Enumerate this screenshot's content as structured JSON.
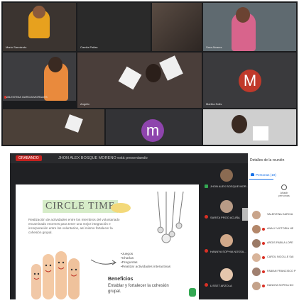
{
  "top_grid": {
    "tiles": [
      {
        "name": "Mario Sarmiento"
      },
      {
        "name": "Camila Pallas"
      },
      {
        "name": ""
      },
      {
        "name": "Sara Alvarez"
      },
      {
        "name": "VALENTINA GARCIA MORALES"
      },
      {
        "name": "Angelic"
      },
      {
        "name": "Martha Solis"
      },
      {
        "name": ""
      },
      {
        "name": ""
      },
      {
        "name": ""
      }
    ],
    "avatar_m_red": "M",
    "avatar_m_purple": "m"
  },
  "meet": {
    "rec_label": "GRABANDO",
    "presenter_text": "JHON ALEX BOSQUE MORENO está presentando",
    "slide": {
      "title": "CIRCLE TIME",
      "paragraph": "Realización de actividades entre los miembros del voluntariado encaminado enormes para tener una mejor integración e incorporación entre los voluntarios, así mismo fortalecer la cohesión grupal.",
      "bullets": [
        "•Juegos",
        "•Charlas",
        "•Preguntas",
        "•Realizar actividades interactivas"
      ],
      "benefits_title": "Beneficios",
      "benefits_text": "Entablar y fortalecer la cohesión grupal."
    },
    "participants_strip": [
      {
        "name": "JHON ALEX BOSQUE MOR..."
      },
      {
        "name": "SARITA PROO ACUÑA"
      },
      {
        "name": "HANNYA SOPHIA NOSSA..."
      },
      {
        "name": "LISSET ARZOLA"
      }
    ]
  },
  "panel": {
    "title": "Detalles de la reunión",
    "tab_label": "Personas (19)",
    "add_label": "Añadir personas",
    "people": [
      "VALENTINA GARCIA",
      "ANALY VICTORIA HE",
      "ARGIS FABILA LOPE",
      "CAROL NICOLLE SAI",
      "FABIAN FRANCISCO P",
      "HANNYA SOPHIA NO"
    ]
  },
  "colors": {
    "record": "#c5221f",
    "accent": "#1a73e8",
    "avatar_red": "#c0392b",
    "avatar_purple": "#8e44ad"
  }
}
